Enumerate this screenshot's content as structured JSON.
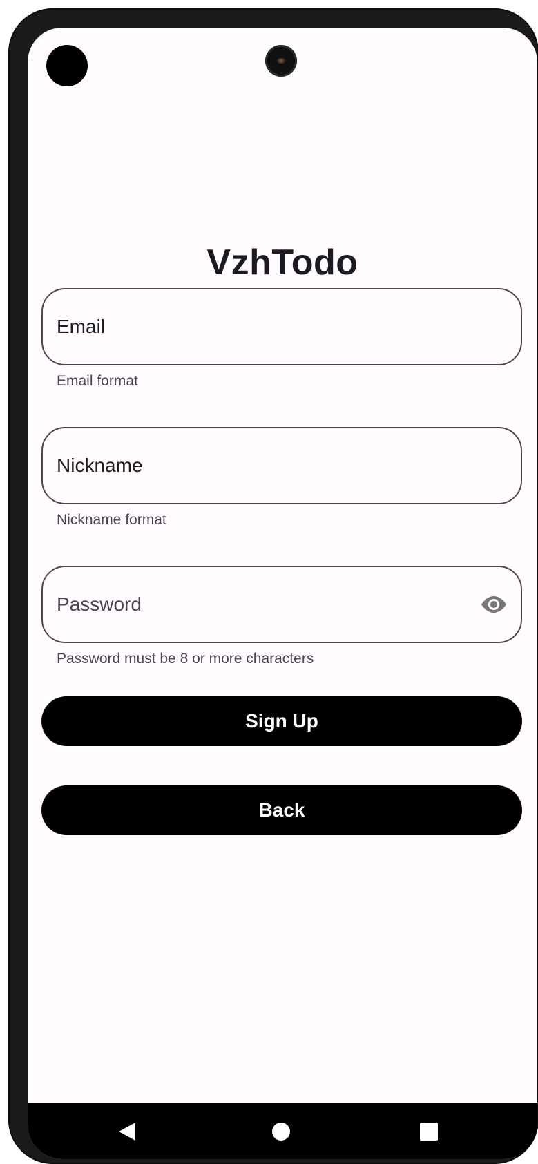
{
  "app": {
    "title": "VzhTodo"
  },
  "form": {
    "email": {
      "placeholder": "Email",
      "value": "",
      "helper": "Email format"
    },
    "nickname": {
      "placeholder": "Nickname",
      "value": "",
      "helper": "Nickname format"
    },
    "password": {
      "placeholder": "Password",
      "value": "",
      "helper": "Password must be 8 or more characters",
      "toggle_icon": "eye-icon"
    }
  },
  "actions": {
    "signup_label": "Sign Up",
    "back_label": "Back"
  },
  "navbar": {
    "back_icon": "triangle-back-icon",
    "home_icon": "circle-home-icon",
    "recents_icon": "square-recents-icon"
  },
  "colors": {
    "background": "#fffbfe",
    "button": "#000000",
    "button_text": "#ffffff",
    "outline": "#4a4a4a",
    "helper_text": "#49454f"
  }
}
